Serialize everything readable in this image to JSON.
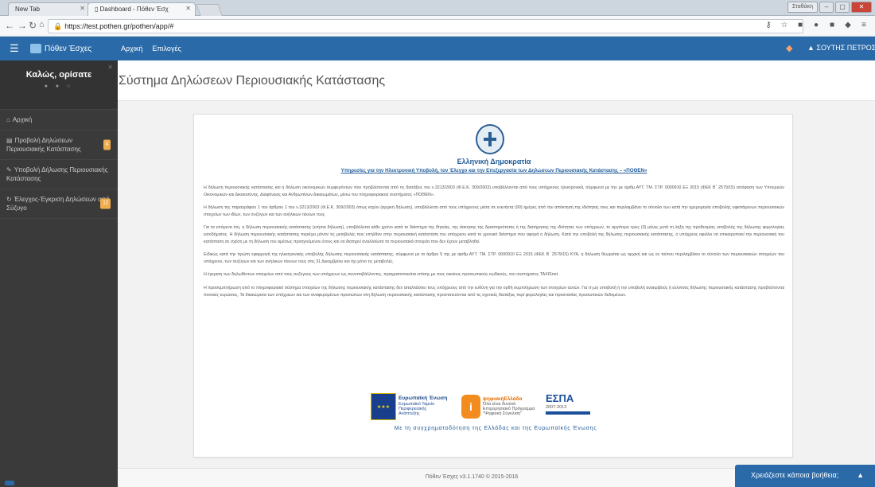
{
  "browser": {
    "tabs": [
      {
        "label": "New Tab"
      },
      {
        "label": "Dashboard - Πόθεν Έσχ"
      }
    ],
    "window_user": "Σταθάκη",
    "url": "https://test.pothen.gr/pothen/app/#"
  },
  "appnav": {
    "brand": "Πόθεν Έσχες",
    "links": [
      {
        "label": "Αρχική"
      },
      {
        "label": "Επιλογές"
      }
    ],
    "user": "ΣΟΥΤΗΣ ΠΕΤΡΟΣ"
  },
  "sidebar": {
    "welcome": "Καλώς, ορίσατε",
    "dots": "● ● ○",
    "items": [
      {
        "icon": "home-icon",
        "glyph": "⌂",
        "label": "Αρχική",
        "badge": ""
      },
      {
        "icon": "list-icon",
        "glyph": "▤",
        "label": "Προβολή Δηλώσεων Περιουσιακής Κατάστασης",
        "badge": "4"
      },
      {
        "icon": "pencil-icon",
        "glyph": "✎",
        "label": "Υποβολή Δήλωσης Περιουσιακής Κατάστασης",
        "badge": ""
      },
      {
        "icon": "refresh-icon",
        "glyph": "↻",
        "label": "Έλεγχος-Έγκριση Δηλώσεων από Σύζυγο",
        "badge": "12"
      }
    ]
  },
  "main": {
    "page_title": "Σύστημα Δηλώσεων Περιουσιακής Κατάστασης",
    "gov_title": "Ελληνική Δημοκρατία",
    "gov_subtitle": "Υπηρεσίες για την Ηλεκτρονική Υποβολή, τον Έλεγχο και την Επεξεργασία των Δηλώσεων Περιουσιακής Κατάστασης – «ΠΟΘΕΝ»",
    "paragraphs": [
      "Η δήλωση περιουσιακής κατάστασης και η δήλωση οικονομικών συμφερόντων που προβλέπονται από τις διατάξεις του ν.3213/2003 (Φ.Ε.Κ. 309/2003) υποβάλλονται από τους υπόχρεους ηλεκτρονικά, σύμφωνα με την με αριθμ.ΑΥΤ. ΤΜ. ΣΤΡ. 0000910 ΕΞ 2015 (ΦΕΚ Β΄ 2579/15) απόφαση των Υπουργών Οικονομικών και Δικαιοσύνης, Διαφάνειας και Ανθρωπίνων Δικαιωμάτων, μέσω του πληροφοριακού συστήματος «ΠΟΘΕΝ».",
      "Η δήλωση της παραγράφου 1 του άρθρου 1 του ν.3213/2003 (Φ.Ε.Κ. 309/2003) όπως ισχύει (αρχική δήλωση), υποβάλλεται από τους υπόχρεους μέσα σε ενενήντα (90) ημέρες από την απόκτηση της ιδιότητας τους και περιλαμβάνει το σύνολο των κατά την ημερομηνία υποβολής υφιστάμενων περιουσιακών στοιχείων των ιδίων, των συζύγων και των ανήλικων τέκνων τους.",
      "Για τα επόμενα έτη, η δήλωση περιουσιακής κατάστασης (ετήσια δήλωση), υποβάλλεται κάθε χρόνο κατά το διάστημα της θητείας, της άσκησης της δραστηριότητας ή της διατήρησης της ιδιότητας των υπόχρεων, το αργότερο τρεις (3) μήνες μετά τη λήξη της προθεσμίας υποβολής της δήλωσης φορολογίας εισοδήματος. Η δήλωση περιουσιακής κατάστασης περιέχει μόνον τις μεταβολές που επήλθαν στην περιουσιακή κατάσταση του υπόχρεου κατά το χρονικό διάστημα που αφορά η δήλωση. Κατά την υποβολή της δήλωσης περιουσιακής κατάστασης, ο υπόχρεος οφείλει να επικαιροποιεί την περιουσιακή του κατάσταση σε σχέση με τη δήλωση του αμέσως προηγούμενου έτους και να διατηρεί αναλλοίωτα τα περιουσιακά στοιχεία που δεν έχουν μεταβληθεί.",
      "Ειδικώς κατά την πρώτη εφαρμογή της ηλεκτρονικής υποβολής δήλωσης περιουσιακής κατάστασης, σύμφωνα με το άρθρο 5 της με αριθμ.ΑΥΤ. ΤΜ. ΣΤΡ. 0000910 ΕΞ 2015 (ΦΕΚ Β΄ 2579/15) ΚΥΑ, η δήλωση θεωρείται ως αρχική και ως εκ τούτου περιλαμβάνει το σύνολο των περιουσιακών στοιχείων του υπόχρεου, των συζύγων και των ανήλικων τέκνων τους στις 31 Δεκεμβρίου και όχι μόνο τις μεταβολές.",
      "Η έγκριση των δηλωθέντων στοιχείων από τους συζύγους των υπόχρεων ως συνυποβάλλοντες, πραγματοποιείται επίσης με τους οικείους προσωπικούς κωδικούς, του συστήματος TAXISnet.",
      "Η προσυμπλήρωση από το πληροφοριακό σύστημα στοιχείων της δήλωσης περιουσιακής κατάστασης δεν απαλλάσσει τους υπόχρεους από την ευθύνη για την ορθή συμπλήρωση των στοιχείων αυτών. Για τη μη υποβολή ή την υποβολή ανακριβούς ή ελλιπούς δήλωσης περιουσιακής κατάστασης προβλέπονται ποινικές κυρώσεις. Τα δικαιώματα των υπόχρεων και των αναφερομένων προσώπων στη δήλωση περιουσιακής κατάστασης προστατεύονται από τις σχετικές διατάξεις περί φορολογίας και προστασίας προσωπικών δεδομένων."
    ],
    "logos": {
      "eu": [
        "Ευρωπαϊκή Ένωση",
        "Ευρωπαϊκό Ταμείο",
        "Περιφερειακής",
        "Ανάπτυξης"
      ],
      "dg": [
        "ψηφιακήΕλλάδα",
        "Όλα είναι δυνατά",
        "Επιχειρησιακό Πρόγραμμα",
        "\"Ψηφιακή Σύγκλιση\""
      ],
      "espa": "ΕΣΠΑ",
      "espa_years": "2007-2013",
      "cofinance": "Με τη συγχρηματοδότηση της Ελλάδας και της Ευρωπαϊκής Ένωσης"
    },
    "footer": "Πόθεν Έσχες v3.1.1740 © 2015-2016",
    "help": "Χρειάζεστε κάποια βοήθεια;"
  },
  "colors": {
    "nav_blue": "#2a6aa8",
    "sidebar_bg": "#3a3a3a",
    "badge_orange": "#f0ad4e",
    "gov_blue": "#1f5b99"
  }
}
